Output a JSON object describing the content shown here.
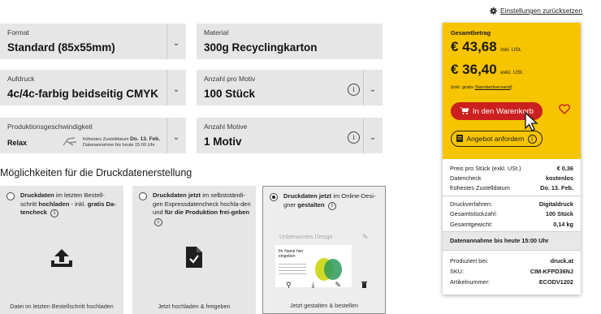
{
  "header": {
    "reset_label": "Einstellungen zurücksetzen"
  },
  "fields": {
    "format": {
      "label": "Format",
      "value": "Standard (85x55mm)"
    },
    "material": {
      "label": "Material",
      "value": "300g Recyclingkarton"
    },
    "print": {
      "label": "Aufdruck",
      "value": "4c/4c-farbig beidseitig CMYK"
    },
    "qty_per_motif": {
      "label": "Anzahl pro Motiv",
      "value": "100 Stück"
    },
    "speed": {
      "label": "Produktionsgeschwindigkeit",
      "value": "Relax",
      "delivery_prefix": "frühestes Zustelldatum",
      "delivery_date": "Do. 13. Feb.",
      "delivery_note": "Datenannahme bis heute 15:00 Uhr"
    },
    "motifs": {
      "label": "Anzahl Motive",
      "value": "1 Motiv"
    }
  },
  "options_title": "Möglichkeiten für die Druckdatenerstellung",
  "options": [
    {
      "t1": "Druckdaten",
      "t2": " im letzten Bestell-schritt ",
      "t3": "hochladen",
      "t4": " - inkl. ",
      "t5": "gratis Da-tencheck",
      "footer": "Datei im letzten Bestellschritt hochladen"
    },
    {
      "t1": "Druckdaten jetzt",
      "t2": " im selbstständi-gen Expressdatencheck hochla-den und ",
      "t3": "für die Produktion frei-geben",
      "footer": "Jetzt hochladen & freigeben"
    },
    {
      "t1": "Druckdaten jetzt",
      "t2": " im Online-Desi-gner ",
      "t3": "gestalten",
      "design_name": "Unbenanntes Design",
      "card_title": "Ihr Name hier eingeben",
      "footer": "Jetzt gestalten & bestellen"
    }
  ],
  "summary": {
    "title": "Gesamtbetrag",
    "gross": "€ 43,68",
    "gross_suffix": "inkl. USt.",
    "net": "€ 36,40",
    "net_suffix": "exkl. USt.",
    "shipping_prefix": "(inkl. gratis ",
    "shipping_link": "Standardversand",
    "shipping_suffix": ")",
    "cart_button": "In den Warenkorb",
    "quote_button": "Angebot anfordern",
    "rows1": [
      {
        "k": "Preis pro Stück (exkl. USt.)",
        "v": "€ 0,36"
      },
      {
        "k": "Datencheck",
        "v": "kostenlos"
      },
      {
        "k": "frühestes Zustelldatum",
        "v": "Do. 13. Feb."
      }
    ],
    "rows2": [
      {
        "k": "Druckverfahren:",
        "v": "Digitaldruck"
      },
      {
        "k": "Gesamtstückzahl:",
        "v": "100 Stück"
      },
      {
        "k": "Gesamtgewicht:",
        "v": "0,14 kg"
      }
    ],
    "deadline": "Datenannahme bis heute 15:00 Uhr",
    "rows3": [
      {
        "k": "Produziert bei:",
        "v": "druck.at"
      },
      {
        "k": "SKU:",
        "v": "CIM-KFPD36NJ"
      },
      {
        "k": "Artikelnummer:",
        "v": "ECODV1202"
      }
    ]
  },
  "colors": {
    "accent_yellow": "#f7c400",
    "cart_red": "#cc1f1f"
  }
}
